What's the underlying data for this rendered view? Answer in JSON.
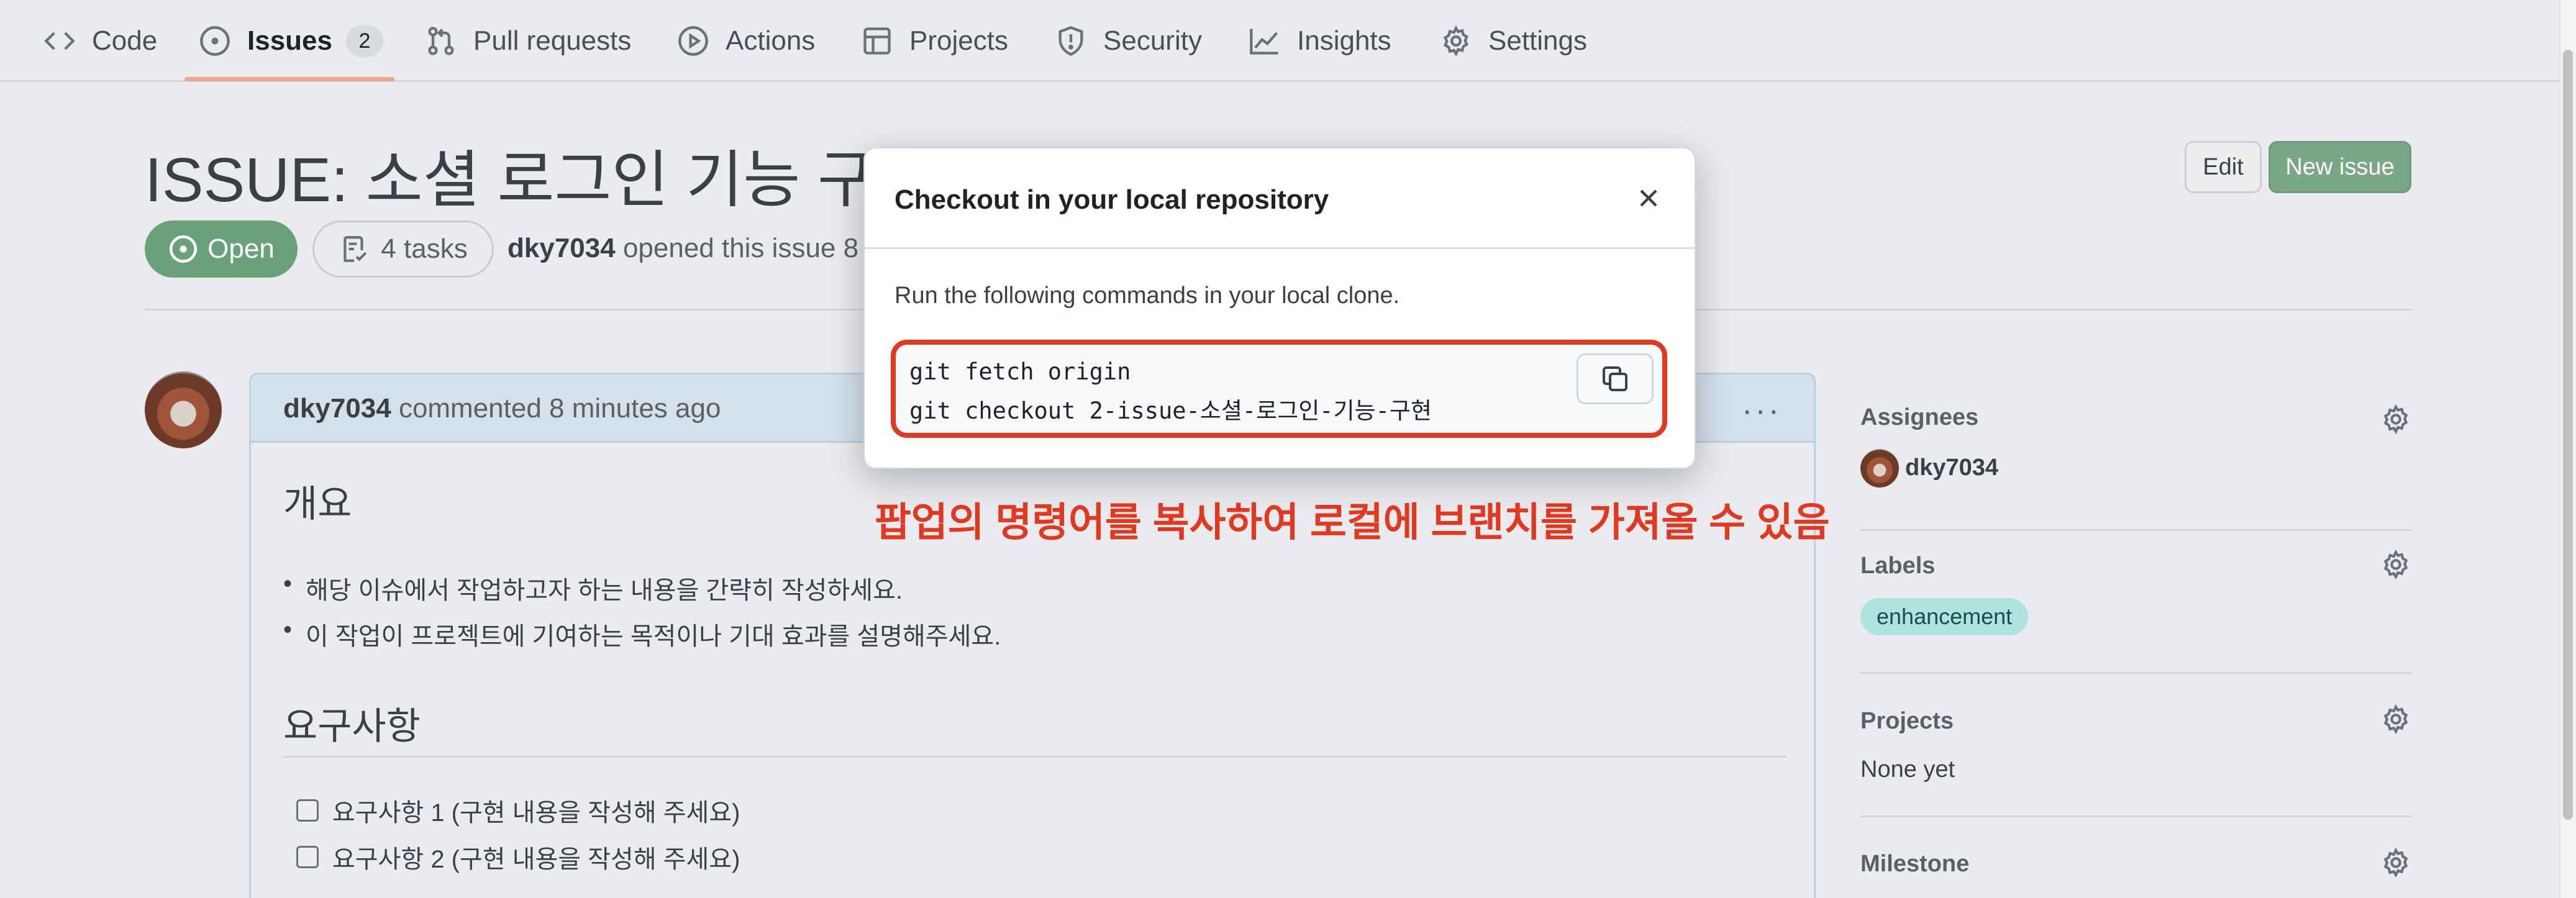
{
  "nav": {
    "code": "Code",
    "issues": "Issues",
    "issues_count": "2",
    "pull_requests": "Pull requests",
    "actions": "Actions",
    "projects": "Projects",
    "security": "Security",
    "insights": "Insights",
    "settings": "Settings"
  },
  "header": {
    "title": "ISSUE: 소셜 로그인 기능 구현 #",
    "edit_label": "Edit",
    "new_issue_label": "New issue",
    "state": "Open",
    "tasks": "4 tasks",
    "author": "dky7034",
    "opened_text": "opened this issue 8"
  },
  "comment": {
    "author": "dky7034",
    "time_text": "commented 8 minutes ago",
    "menu": "···",
    "section1_title": "개요",
    "bullets": [
      "해당 이슈에서 작업하고자 하는 내용을 간략히 작성하세요.",
      "이 작업이 프로젝트에 기여하는 목적이나 기대 효과를 설명해주세요."
    ],
    "section2_title": "요구사항",
    "tasks": [
      "요구사항 1 (구현 내용을 작성해 주세요)",
      "요구사항 2 (구현 내용을 작성해 주세요)"
    ]
  },
  "sidebar": {
    "assignees_label": "Assignees",
    "assignee": "dky7034",
    "labels_label": "Labels",
    "label": "enhancement",
    "projects_label": "Projects",
    "projects_value": "None yet",
    "milestone_label": "Milestone"
  },
  "modal": {
    "title": "Checkout in your local repository",
    "description": "Run the following commands in your local clone.",
    "cmd1": "git fetch origin",
    "cmd2": "git checkout 2-issue-소셜-로그인-기능-구현"
  },
  "annotation": "팝업의 명령어를 복사하여 로컬에 브랜치를 가져올 수 있음",
  "colors": {
    "accent_red": "#e2381f",
    "open_green": "#6aa07a",
    "label_teal": "#aee3df"
  }
}
